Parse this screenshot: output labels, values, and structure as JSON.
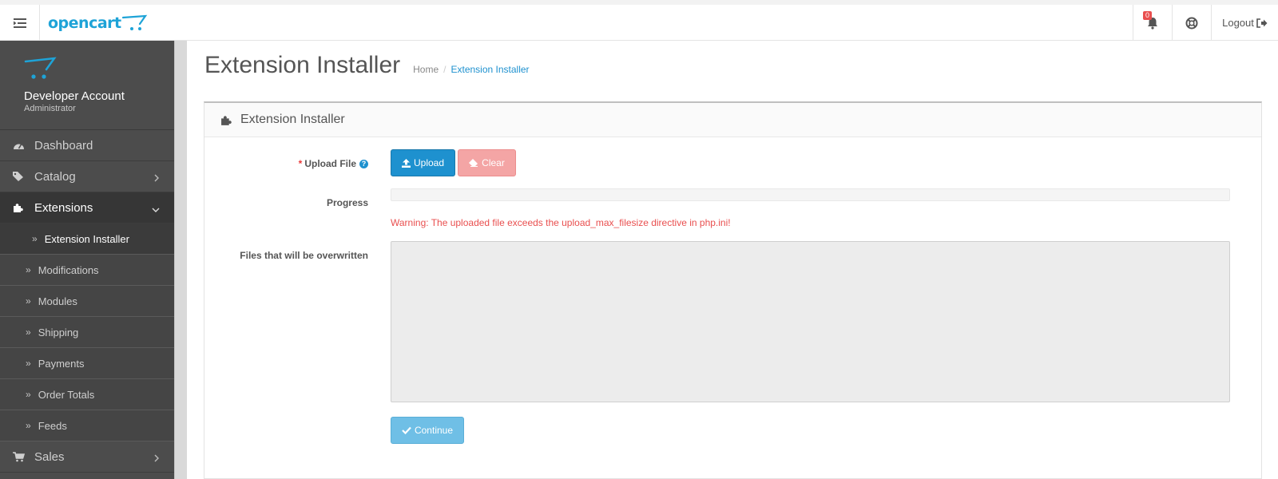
{
  "header": {
    "logo_text": "opencart",
    "notification_count": "0",
    "logout_label": "Logout"
  },
  "sidebar": {
    "profile_name": "Developer Account",
    "profile_role": "Administrator",
    "items": [
      {
        "label": "Dashboard",
        "icon": "dashboard-icon"
      },
      {
        "label": "Catalog",
        "icon": "tags-icon"
      },
      {
        "label": "Extensions",
        "icon": "puzzle-icon"
      }
    ],
    "extension_subitems": [
      "Extension Installer",
      "Modifications",
      "Modules",
      "Shipping",
      "Payments",
      "Order Totals",
      "Feeds"
    ],
    "sales_label": "Sales"
  },
  "page": {
    "title": "Extension Installer",
    "breadcrumb_home": "Home",
    "breadcrumb_current": "Extension Installer"
  },
  "panel": {
    "title": "Extension Installer",
    "upload_file_label": "Upload File",
    "upload_button": "Upload",
    "clear_button": "Clear",
    "progress_label": "Progress",
    "progress_percent": 0,
    "warning_text": "Warning: The uploaded file exceeds the upload_max_filesize directive in php.ini!",
    "overwritten_label": "Files that will be overwritten",
    "overwritten_value": "",
    "continue_button": "Continue"
  },
  "colors": {
    "brand": "#1ea3d7",
    "primary": "#1e91cf",
    "danger": "#e94f4f",
    "sidebar_bg": "#4c4c4c"
  }
}
